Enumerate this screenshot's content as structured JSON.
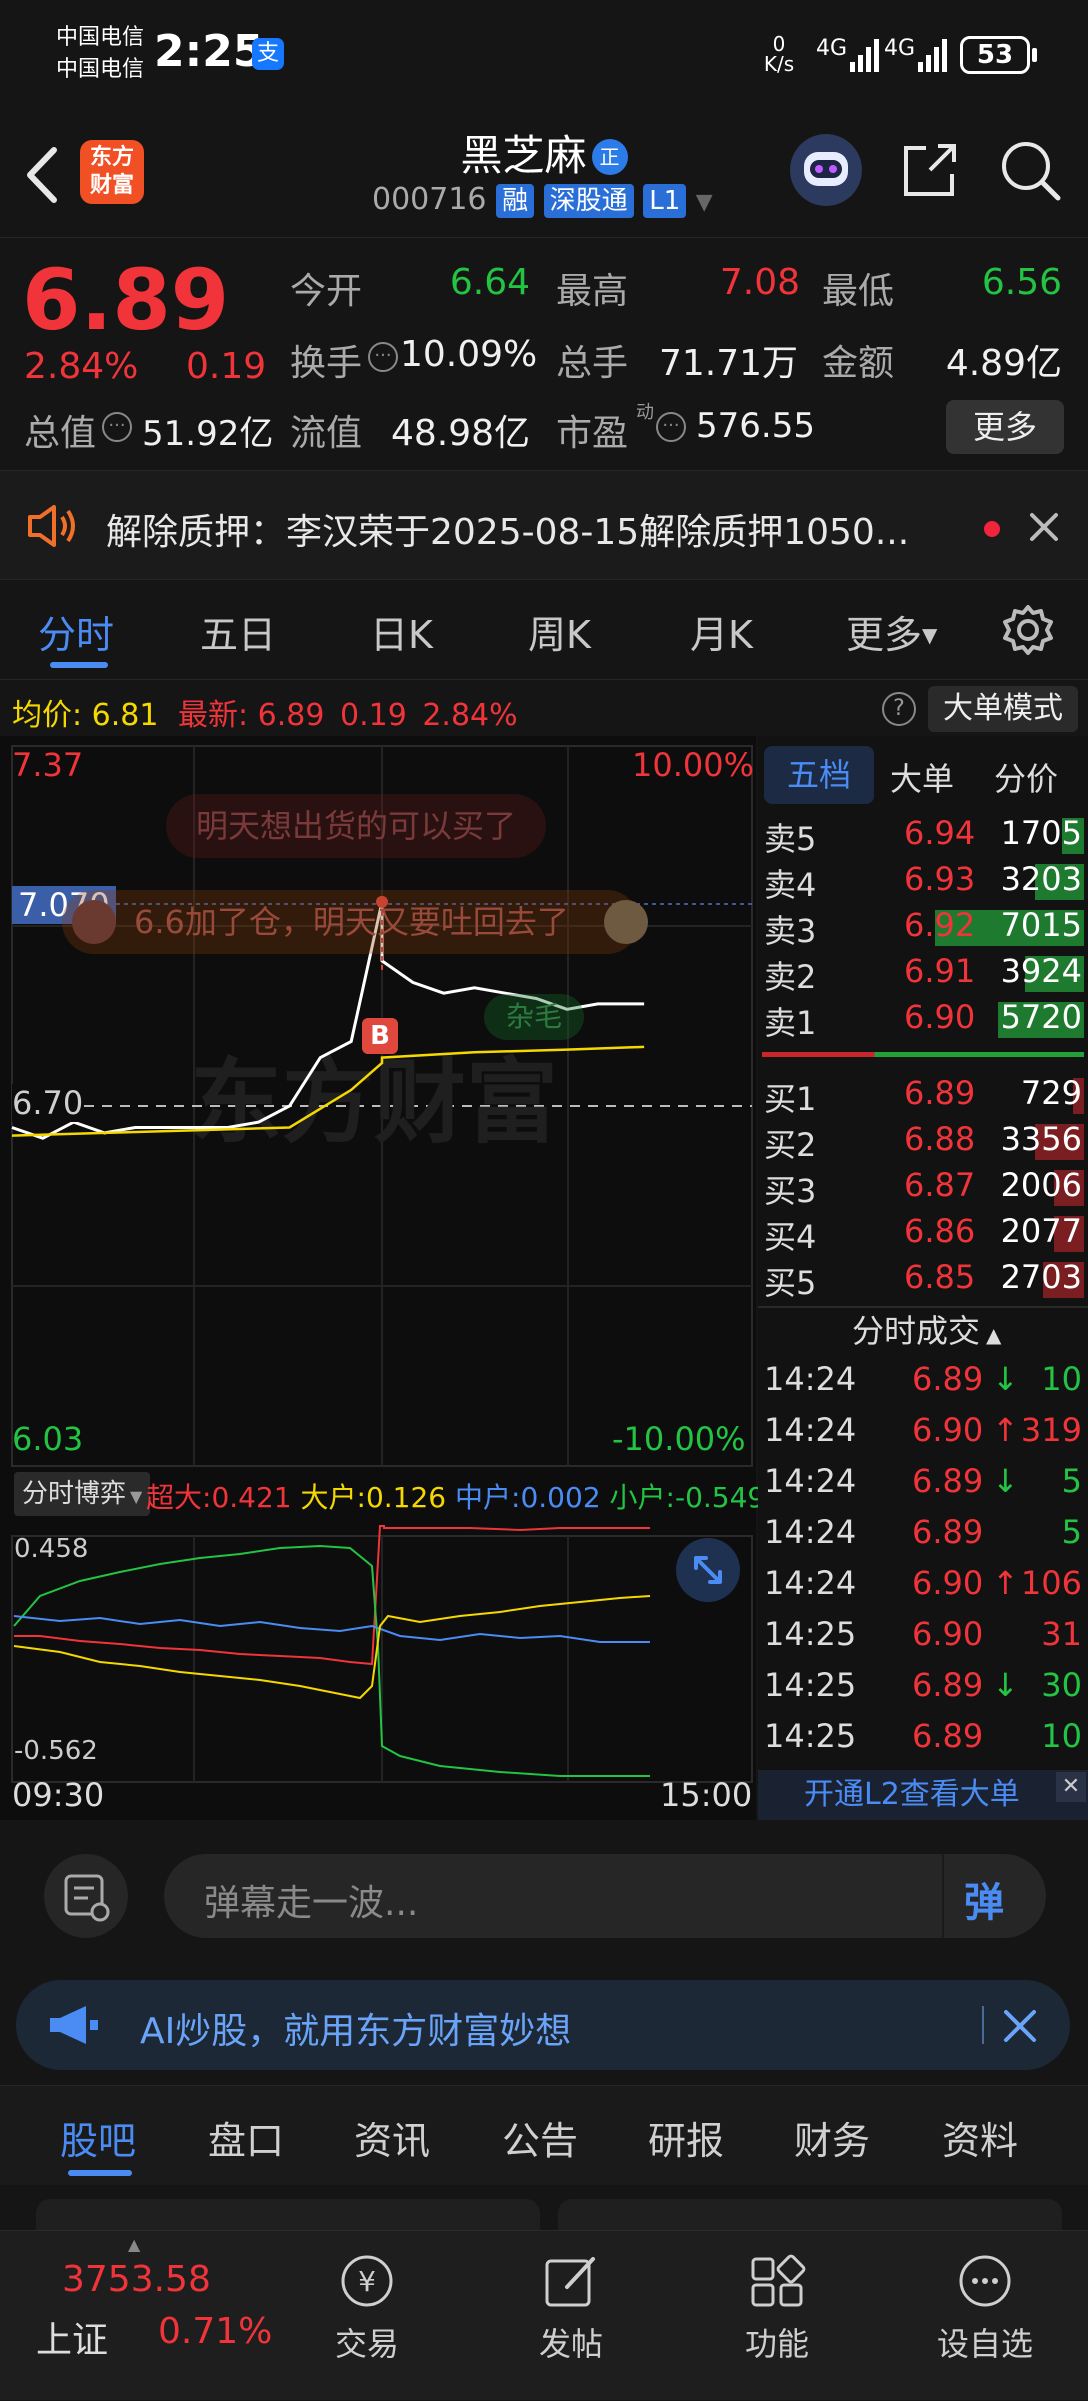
{
  "status_bar": {
    "carrier1": "中国电信",
    "carrier2": "中国电信",
    "time": "2:25",
    "alipay_icon": "支",
    "net_speed_value": "0",
    "net_speed_unit": "K/s",
    "signal1": "4G",
    "signal2": "4G",
    "battery": "53"
  },
  "header": {
    "logo_line1": "东方",
    "logo_line2": "财富",
    "stock_name": "黑芝麻",
    "name_badge": "正",
    "stock_code": "000716",
    "badge_rong": "融",
    "badge_sgt": "深股通",
    "badge_l1": "L1"
  },
  "quote": {
    "price": "6.89",
    "change_pct": "2.84%",
    "change_amt": "0.19",
    "open_label": "今开",
    "open_value": "6.64",
    "high_label": "最高",
    "high_value": "7.08",
    "low_label": "最低",
    "low_value": "6.56",
    "turnover_label": "换手",
    "turnover_value": "10.09%",
    "volume_label": "总手",
    "volume_value": "71.71万",
    "amount_label": "金额",
    "amount_value": "4.89亿",
    "mktcap_label": "总值",
    "mktcap_value": "51.92亿",
    "float_label": "流值",
    "float_value": "48.98亿",
    "pe_label": "市盈",
    "pe_sup": "动",
    "pe_value": "576.55",
    "more_button": "更多"
  },
  "notice": {
    "text": "解除质押：李汉荣于2025-08-15解除质押1050..."
  },
  "tabs": [
    "分时",
    "五日",
    "日K",
    "周K",
    "月K",
    "更多"
  ],
  "info_row": {
    "avg_label": "均价:",
    "avg_value": "6.81",
    "latest_label": "最新:",
    "latest_value": "6.89",
    "latest_change": "0.19",
    "latest_pct": "2.84%",
    "big_order_button": "大单模式"
  },
  "chart": {
    "y_top_price": "7.37",
    "y_top_pct": "10.00%",
    "y_mark_price": "7.070",
    "y_mid_price": "6.70",
    "y_bottom_price": "6.03",
    "y_bottom_pct": "-10.00%",
    "danmu1": "明天想出货的可以买了",
    "danmu2": "6.6加了仓，明天又要吐回去了",
    "danmu3": "杂毛",
    "buy_marker": "B",
    "watermark": "东方财富",
    "flow_selector": "分时博弈",
    "flow_super_label": "超大:",
    "flow_super_value": "0.421",
    "flow_big_label": "大户:",
    "flow_big_value": "0.126",
    "flow_mid_label": "中户:",
    "flow_mid_value": "0.002",
    "flow_small_label": "小户:",
    "flow_small_value": "-0.549",
    "flow_max": "0.458",
    "flow_min": "-0.562",
    "time_start": "09:30",
    "time_end": "15:00"
  },
  "chart_data": {
    "type": "line",
    "title": "",
    "xlabel": "",
    "ylabel": "",
    "x_range": [
      "09:30",
      "15:00"
    ],
    "ylim": [
      6.03,
      7.37
    ],
    "prev_close": 6.7,
    "series": [
      {
        "name": "",
        "color": "#ffffff",
        "x": [
          "09:30",
          "09:40",
          "09:50",
          "10:00",
          "10:10",
          "10:20",
          "10:30",
          "10:40",
          "10:50",
          "11:00",
          "11:10",
          "11:20",
          "11:30",
          "13:00",
          "13:10",
          "13:20",
          "13:30",
          "13:40",
          "13:50",
          "14:00",
          "14:10",
          "14:20",
          "14:25"
        ],
        "values": [
          6.66,
          6.64,
          6.67,
          6.65,
          6.66,
          6.66,
          6.66,
          6.66,
          6.67,
          6.7,
          6.79,
          6.82,
          7.08,
          6.97,
          6.93,
          6.91,
          6.92,
          6.91,
          6.9,
          6.88,
          6.89,
          6.89,
          6.89
        ]
      },
      {
        "name": "",
        "color": "#f5d800",
        "x": [
          "09:30",
          "10:00",
          "10:30",
          "11:00",
          "11:20",
          "11:30",
          "13:00",
          "13:30",
          "14:00",
          "14:25"
        ],
        "values": [
          6.645,
          6.65,
          6.655,
          6.66,
          6.73,
          6.78,
          6.79,
          6.8,
          6.805,
          6.81
        ]
      }
    ]
  },
  "order_book": {
    "tabs": [
      "五档",
      "大单",
      "分价"
    ],
    "asks": [
      {
        "label": "卖5",
        "price": "6.94",
        "volume": "1705",
        "fill": 0.08
      },
      {
        "label": "卖4",
        "price": "6.93",
        "volume": "3203",
        "fill": 0.18
      },
      {
        "label": "卖3",
        "price": "6.92",
        "volume": "7015",
        "fill": 0.55
      },
      {
        "label": "卖2",
        "price": "6.91",
        "volume": "3924",
        "fill": 0.22
      },
      {
        "label": "卖1",
        "price": "6.90",
        "volume": "5720",
        "fill": 0.32
      }
    ],
    "bids": [
      {
        "label": "买1",
        "price": "6.89",
        "volume": "729",
        "fill": 0.04
      },
      {
        "label": "买2",
        "price": "6.88",
        "volume": "3356",
        "fill": 0.18
      },
      {
        "label": "买3",
        "price": "6.87",
        "volume": "2006",
        "fill": 0.11
      },
      {
        "label": "买4",
        "price": "6.86",
        "volume": "2077",
        "fill": 0.11
      },
      {
        "label": "买5",
        "price": "6.85",
        "volume": "2703",
        "fill": 0.15
      }
    ],
    "trades_title": "分时成交",
    "trades": [
      {
        "time": "14:24",
        "price": "6.89",
        "dir": "↓",
        "vol": "10",
        "pc": "red",
        "vc": "green"
      },
      {
        "time": "14:24",
        "price": "6.90",
        "dir": "↑",
        "vol": "319",
        "pc": "red",
        "vc": "red"
      },
      {
        "time": "14:24",
        "price": "6.89",
        "dir": "↓",
        "vol": "5",
        "pc": "red",
        "vc": "green"
      },
      {
        "time": "14:24",
        "price": "6.89",
        "dir": "",
        "vol": "5",
        "pc": "red",
        "vc": "green"
      },
      {
        "time": "14:24",
        "price": "6.90",
        "dir": "↑",
        "vol": "106",
        "pc": "red",
        "vc": "red"
      },
      {
        "time": "14:25",
        "price": "6.90",
        "dir": "",
        "vol": "31",
        "pc": "red",
        "vc": "red"
      },
      {
        "time": "14:25",
        "price": "6.89",
        "dir": "↓",
        "vol": "30",
        "pc": "red",
        "vc": "green"
      },
      {
        "time": "14:25",
        "price": "6.89",
        "dir": "",
        "vol": "10",
        "pc": "red",
        "vc": "green"
      }
    ],
    "l2_banner": "开通L2查看大单"
  },
  "danmu_input": {
    "placeholder": "弹幕走一波...",
    "send_label": "弹"
  },
  "ai_banner": {
    "text": "AI炒股，就用东方财富妙想"
  },
  "bottom_tabs": [
    "股吧",
    "盘口",
    "资讯",
    "公告",
    "研报",
    "财务",
    "资料"
  ],
  "nav": {
    "index_value": "3753.58",
    "index_name": "上证",
    "index_pct": "0.71%",
    "items": [
      {
        "label": "交易",
        "icon": "yen-exchange-icon"
      },
      {
        "label": "发帖",
        "icon": "edit-icon"
      },
      {
        "label": "功能",
        "icon": "grid-icon"
      },
      {
        "label": "设自选",
        "icon": "more-icon"
      }
    ]
  },
  "colors": {
    "up": "#f0343a",
    "down": "#23c343",
    "avg_line": "#f5d800",
    "accent": "#4a8cf4"
  }
}
